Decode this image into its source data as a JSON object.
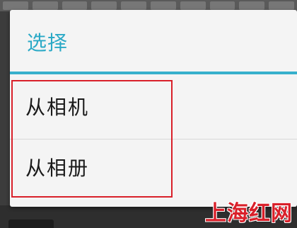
{
  "dialog": {
    "title": "选择",
    "options": [
      {
        "label": "从相机"
      },
      {
        "label": "从相册"
      }
    ]
  },
  "watermark": "上海红网",
  "colors": {
    "title": "#2aa9c6",
    "divider": "#37b0cc",
    "highlight": "#d9202a",
    "dialog_bg": "#f4f4f4"
  }
}
